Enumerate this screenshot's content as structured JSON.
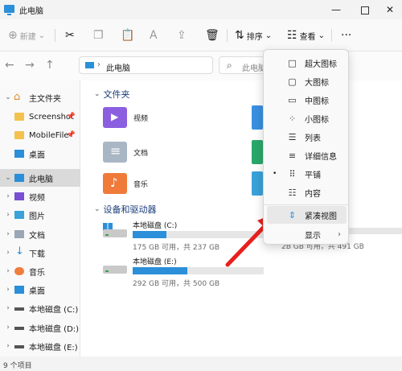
{
  "window": {
    "title": "此电脑",
    "min": "—",
    "close": "✕"
  },
  "toolbar": {
    "new_label": "新建",
    "sort_label": "排序",
    "view_label": "查看",
    "more": "···",
    "icons": {
      "new": "⊕",
      "cut": "✂",
      "copy": "❐",
      "paste": "📋",
      "rename": "A",
      "share": "⇪",
      "delete": "🗑",
      "sort": "⇅",
      "view": "☷",
      "chev": "⌄"
    }
  },
  "nav": {
    "back": "←",
    "forward": "→",
    "up": "↑"
  },
  "address": {
    "chevron": "›",
    "path": "此电脑",
    "dropdown": "⌄",
    "refresh": "↻"
  },
  "search": {
    "icon": "⌕",
    "placeholder": "此电脑"
  },
  "sidebar": {
    "items": [
      {
        "label": "主文件夹",
        "chevron": "⌄",
        "icon": "home-icon"
      },
      {
        "label": "Screenshot",
        "icon": "folder-icon",
        "pin": "📌"
      },
      {
        "label": "MobileFile",
        "icon": "folder-icon",
        "pin": "📌"
      },
      {
        "label": "桌面",
        "icon": "desktop-icon"
      },
      {
        "label": "此电脑",
        "chevron": "⌄",
        "icon": "pc-icon"
      },
      {
        "label": "视频",
        "chevron": "›",
        "icon": "video-icon"
      },
      {
        "label": "图片",
        "chevron": "›",
        "icon": "picture-icon"
      },
      {
        "label": "文档",
        "chevron": "›",
        "icon": "document-icon"
      },
      {
        "label": "下载",
        "chevron": "›",
        "icon": "download-icon"
      },
      {
        "label": "音乐",
        "chevron": "›",
        "icon": "music-icon"
      },
      {
        "label": "桌面",
        "chevron": "›",
        "icon": "desktop-icon"
      },
      {
        "label": "本地磁盘 (C:)",
        "chevron": "›",
        "icon": "disk-icon"
      },
      {
        "label": "本地磁盘 (D:)",
        "chevron": "›",
        "icon": "disk-icon"
      },
      {
        "label": "本地磁盘 (E:)",
        "chevron": "›",
        "icon": "disk-icon"
      }
    ]
  },
  "content": {
    "folders_header": "文件夹",
    "drives_header": "设备和驱动器",
    "header_chevron": "⌄",
    "folders": [
      {
        "label": "视频",
        "icon": "video-folder-icon"
      },
      {
        "label": "文档",
        "icon": "document-folder-icon"
      },
      {
        "label": "音乐",
        "icon": "music-folder-icon"
      }
    ],
    "drives": [
      {
        "name": "本地磁盘 (C:)",
        "info": "175 GB 可用，共 237 GB",
        "used_fraction": 0.26
      },
      {
        "name": "本地磁盘 (E:)",
        "info": "292 GB 可用，共 500 GB",
        "used_fraction": 0.42
      }
    ],
    "partial_drive_info": "2B GB 可用，共 491 GB"
  },
  "view_menu": {
    "items": [
      {
        "label": "超大图标",
        "icon": "□",
        "icon_name": "extra-large-icons-icon"
      },
      {
        "label": "大图标",
        "icon": "▢",
        "icon_name": "large-icons-icon"
      },
      {
        "label": "中图标",
        "icon": "▭",
        "icon_name": "medium-icons-icon"
      },
      {
        "label": "小图标",
        "icon": "⁘",
        "icon_name": "small-icons-icon"
      },
      {
        "label": "列表",
        "icon": "☰",
        "icon_name": "list-icon"
      },
      {
        "label": "详细信息",
        "icon": "≡",
        "icon_name": "details-icon"
      },
      {
        "label": "平铺",
        "icon": "⠿",
        "icon_name": "tiles-icon",
        "bullet": "•"
      },
      {
        "label": "内容",
        "icon": "☷",
        "icon_name": "content-icon"
      },
      {
        "label": "紧凑视图",
        "icon": "⇕",
        "icon_name": "compact-view-icon"
      },
      {
        "label": "显示",
        "icon": "",
        "icon_name": "",
        "arrow": "›"
      }
    ]
  },
  "status": {
    "text": "9 个项目"
  },
  "colors": {
    "accent": "#2b8fd9",
    "annotation_arrow": "#e8201d"
  }
}
